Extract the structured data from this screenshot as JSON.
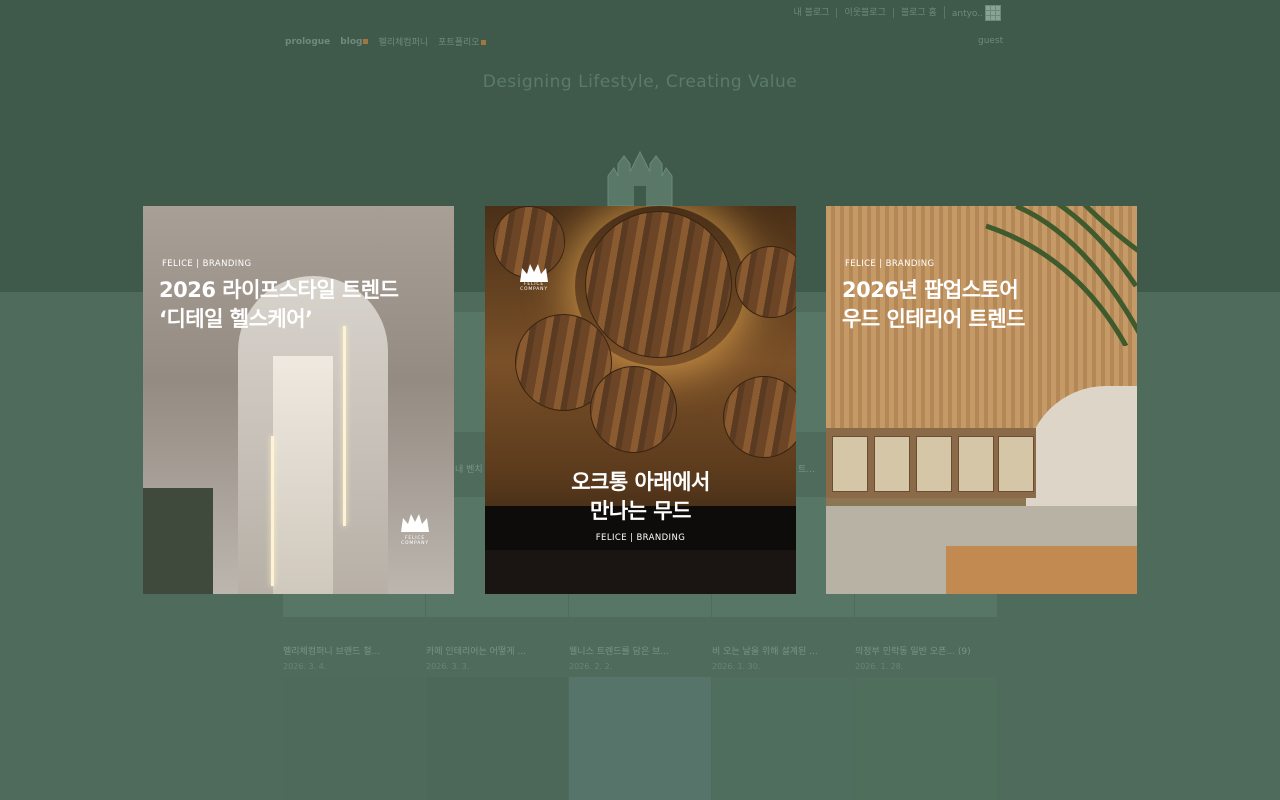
{
  "colors": {
    "top_band": "#3f594b",
    "bottom_band": "#4e6b5c",
    "muted_text": "#6f8a7c",
    "accent_dot": "#a0763f"
  },
  "header": {
    "top_links": [
      "내 블로그",
      "이웃블로그",
      "블로그 홈",
      "antyo.."
    ],
    "guest_label": "guest",
    "grid_icon": "grid-icon"
  },
  "nav": {
    "items": [
      "prologue",
      "blog",
      "펠리체컴퍼니",
      "포트폴리오"
    ]
  },
  "tagline": "Designing Lifestyle, Creating Value",
  "cards": [
    {
      "kicker": "FELICE | BRANDING",
      "headline_line1": "2026 라이프스타일 트렌드",
      "headline_line2": "‘디테일 헬스케어’",
      "logo_text": "FELICE COMPANY"
    },
    {
      "logo_text": "FELICE COMPANY",
      "headline_line1": "오크통 아래에서",
      "headline_line2": "만나는 무드",
      "kicker": "FELICE | BRANDING"
    },
    {
      "kicker": "FELICE | BRANDING",
      "headline_line1": "2026년 팝업스토어",
      "headline_line2": "우드 인테리어 트렌드"
    }
  ],
  "posts": [
    {
      "title": "펠리체컴퍼니 브랜드 철...",
      "date": "2026. 3. 4."
    },
    {
      "title": "카페 인테리어는 어떻게 ...",
      "date": "2026. 3. 3."
    },
    {
      "title": "웰니스 트렌드를 담은 브...",
      "date": "2026. 2. 2."
    },
    {
      "title": "비 오는 날을 위해 설계된 ...",
      "date": "2026. 1. 30."
    },
    {
      "title": "의정부 민락동 일반 오픈... (9)",
      "date": "2026. 1. 28."
    }
  ],
  "side_labels": {
    "left": "내 벤치",
    "right": "트..."
  }
}
